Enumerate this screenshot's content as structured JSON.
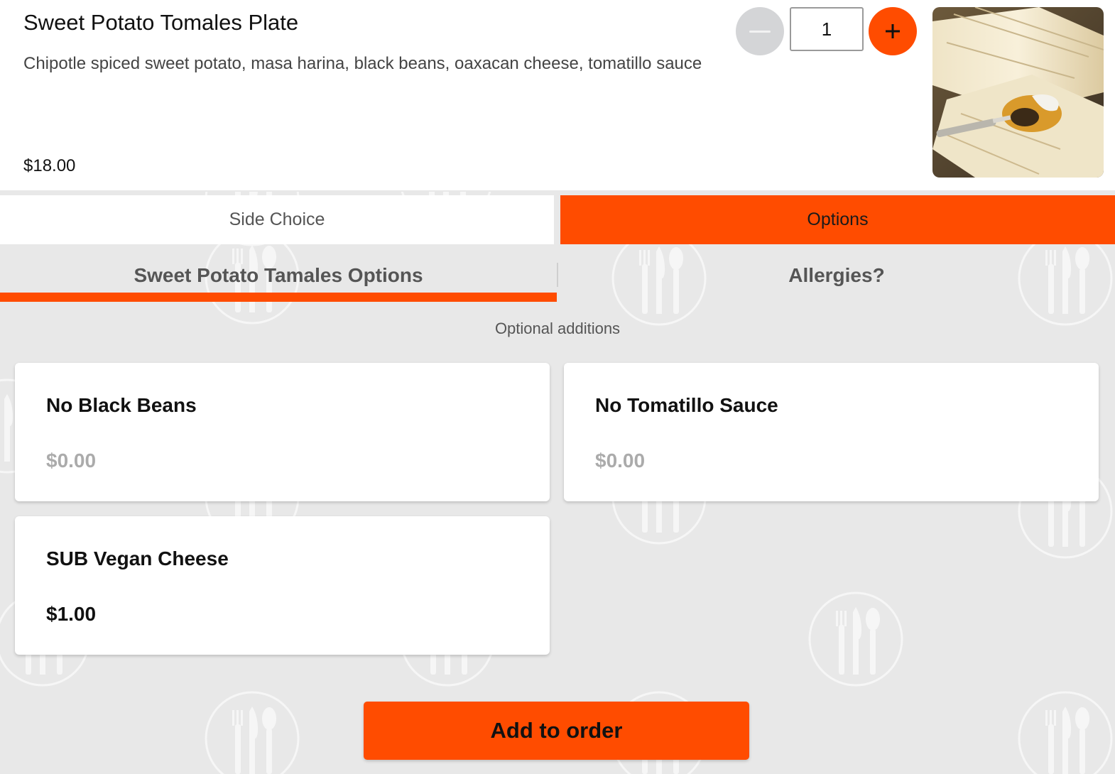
{
  "item": {
    "title": "Sweet Potato Tomales Plate",
    "description": "Chipotle spiced sweet potato, masa harina, black beans, oaxacan cheese, tomatillo sauce",
    "price": "$18.00"
  },
  "quantity": {
    "value": "1"
  },
  "tabs": {
    "side_choice": "Side Choice",
    "options": "Options"
  },
  "subtabs": {
    "main": "Sweet Potato Tamales Options",
    "allergies": "Allergies?"
  },
  "section_label": "Optional additions",
  "options": [
    {
      "name": "No Black Beans",
      "price": "$0.00"
    },
    {
      "name": "No Tomatillo Sauce",
      "price": "$0.00"
    },
    {
      "name": "SUB Vegan Cheese",
      "price": "$1.00"
    }
  ],
  "add_button": "Add to order",
  "icons": {
    "minus": "minus-icon",
    "plus": "plus-icon",
    "background": "fork-knife-spoon-icon"
  },
  "colors": {
    "accent": "#ff4c00",
    "background": "#e8e8e8",
    "muted_price": "#ababab"
  }
}
